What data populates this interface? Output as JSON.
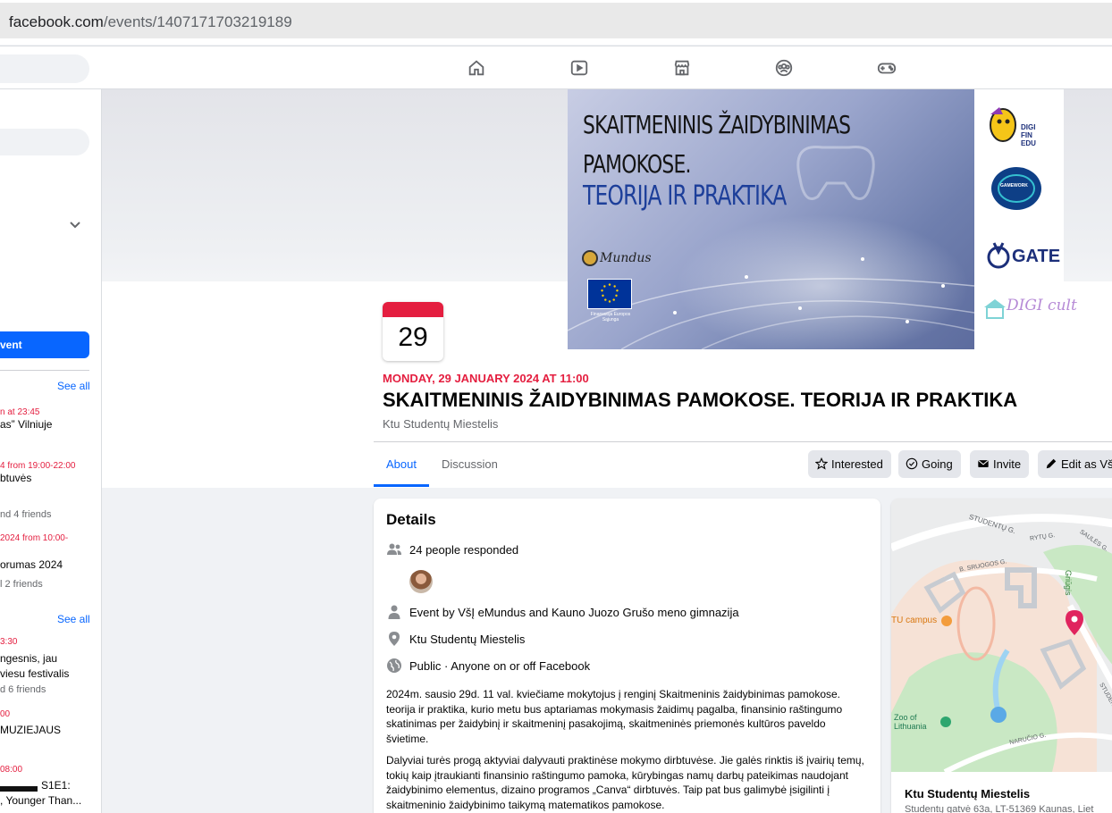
{
  "browser": {
    "url_domain": "facebook.com",
    "url_path": "/events/1407171703219189"
  },
  "nav": {
    "icons": [
      "home-icon",
      "video-icon",
      "marketplace-icon",
      "groups-icon",
      "gaming-icon"
    ]
  },
  "sidebar": {
    "create_label": "vent",
    "see_all_1": "See all",
    "see_all_2": "See all",
    "items": [
      {
        "date": "n at 23:45",
        "title": "as” Vilniuje",
        "friends": ""
      },
      {
        "date": "4 from 19:00-22:00",
        "title": "btuvės",
        "friends": "nd 4 friends"
      },
      {
        "date": "2024 from 10:00-",
        "title": "orumas 2024",
        "friends": "l 2 friends"
      },
      {
        "date": "3:30",
        "title": "ngesnis, jau",
        "title2": "viesu festivalis",
        "friends": "d 6 friends"
      },
      {
        "date": "00",
        "title": "MUZIEJAUS",
        "friends": ""
      },
      {
        "date": "08:00",
        "title": "S1E1:",
        "title2": ", Younger Than...",
        "friends": ""
      }
    ]
  },
  "banner": {
    "line1": "SKAITMENINIS ŽAIDYBINIMAS",
    "line2": "PAMOKOSE.",
    "line3": "TEORIJA IR PRAKTIKA",
    "emundus": "Mundus",
    "eu_caption": "Finansuoja Europos Sąjunga",
    "logo_digifin": "DIGI FIN EDU",
    "logo_gamework": "GAMEWORK",
    "logo_gate": "GATE",
    "logo_digicult": "DIGI cult"
  },
  "event": {
    "day": "29",
    "datetime": "MONDAY, 29 JANUARY 2024 AT 11:00",
    "title": "SKAITMENINIS ŽAIDYBINIMAS PAMOKOSE. TEORIJA IR PRAKTIKA",
    "location": "Ktu Studentų Miestelis"
  },
  "tabs": {
    "about": "About",
    "discussion": "Discussion"
  },
  "actions": {
    "interested": "Interested",
    "going": "Going",
    "invite": "Invite",
    "edit": "Edit as Vš"
  },
  "details": {
    "heading": "Details",
    "responded": "24 people responded",
    "event_by_prefix": "Event by ",
    "org1": "VšĮ eMundus",
    "and": " and ",
    "org2": "Kauno Juozo Grušo meno gimnazija",
    "place": "Ktu Studentų Miestelis",
    "privacy": "Public · Anyone on or off Facebook",
    "desc1": "2024m. sausio 29d. 11 val. kviečiame mokytojus į renginį Skaitmeninis žaidybinimas pamokose. teorija ir praktika, kurio metu bus aptariamas mokymasis žaidimų pagalba, finansinio raštingumo skatinimas per žaidybinį ir skaitmeninį pasakojimą, skaitmeninės priemonės kultūros paveldo švietime.",
    "desc2": "Dalyviai turės progą aktyviai dalyvauti praktinėse mokymo dirbtuvėse. Jie galės rinktis iš įvairių temų, tokių kaip įtraukianti finansinio raštingumo pamoka, kūrybingas namų darbų pateikimas naudojant žaidybinimo elementus, dizaino programos „Canva“ dirbtuvės. Taip pat bus galimybė įsigilinti į skaitmeninio žaidybinimo taikymą matematikos pamokose."
  },
  "map": {
    "street1": "STUDENTŲ G.",
    "street2": "RYTŲ G.",
    "street3": "SAULĖS G.",
    "street4": "B. SRUOGOS G.",
    "street5": "NARUČIO G.",
    "street6": "STUDENT",
    "park": "Griūgis",
    "campus": "TU campus",
    "zoo": "Zoo of Lithuania",
    "title": "Ktu Studentų Miestelis",
    "address": "Studentų gatvė 63a, LT-51369 Kaunas, Liet"
  },
  "colors": {
    "accent": "#0866ff",
    "date_red": "#e41e3f",
    "map_pin": "#e0245e"
  }
}
